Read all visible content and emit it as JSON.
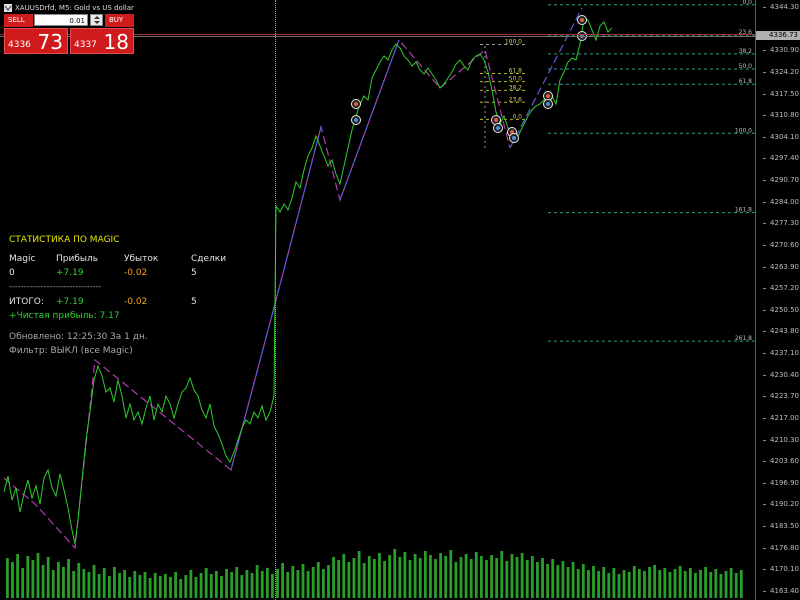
{
  "header": {
    "title": "XAUUSDrfd, M5: Gold vs US dollar"
  },
  "trade_panel": {
    "sell_label": "SELL",
    "buy_label": "BUY",
    "lot_value": "0.01",
    "sell_price_small": "4336",
    "sell_price_big": "73",
    "buy_price_small": "4337",
    "buy_price_big": "18"
  },
  "stats": {
    "title": "СТАТИСТИКА ПО MAGIC",
    "headers": [
      "Magic",
      "Прибыль",
      "Убыток",
      "Сделки"
    ],
    "row": {
      "magic": "0",
      "profit": "+7.19",
      "loss": "-0.02",
      "deals": "5"
    },
    "separator": "--------------------------------",
    "total_label": "ИТОГО:",
    "total_profit": "+7.19",
    "total_loss": "-0.02",
    "total_deals": "5",
    "net_profit": "+Чистая прибыль: 7.17",
    "updated": "Обновлено: 12:25:30",
    "period": "За 1 дн.",
    "filter": "Фильтр: ВЫКЛ (все Magic)"
  },
  "price_axis": {
    "current_price": "4336.73",
    "ticks": [
      {
        "label": "4344.30",
        "y": 4344.3
      },
      {
        "label": "4330.90",
        "y": 4330.9
      },
      {
        "label": "4324.20",
        "y": 4324.2
      },
      {
        "label": "4317.50",
        "y": 4317.5
      },
      {
        "label": "4310.80",
        "y": 4310.8
      },
      {
        "label": "4304.10",
        "y": 4304.1
      },
      {
        "label": "4297.40",
        "y": 4297.4
      },
      {
        "label": "4290.70",
        "y": 4290.7
      },
      {
        "label": "4284.00",
        "y": 4284.0
      },
      {
        "label": "4277.30",
        "y": 4277.3
      },
      {
        "label": "4270.60",
        "y": 4270.6
      },
      {
        "label": "4263.90",
        "y": 4263.9
      },
      {
        "label": "4257.20",
        "y": 4257.2
      },
      {
        "label": "4250.50",
        "y": 4250.5
      },
      {
        "label": "4243.80",
        "y": 4243.8
      },
      {
        "label": "4237.10",
        "y": 4237.1
      },
      {
        "label": "4230.40",
        "y": 4230.4
      },
      {
        "label": "4223.70",
        "y": 4223.7
      },
      {
        "label": "4217.00",
        "y": 4217.0
      },
      {
        "label": "4210.30",
        "y": 4210.3
      },
      {
        "label": "4203.60",
        "y": 4203.6
      },
      {
        "label": "4196.90",
        "y": 4196.9
      },
      {
        "label": "4190.20",
        "y": 4190.2
      },
      {
        "label": "4183.50",
        "y": 4183.5
      },
      {
        "label": "4176.80",
        "y": 4176.8
      },
      {
        "label": "4170.10",
        "y": 4170.1
      },
      {
        "label": "4163.40",
        "y": 4163.4
      }
    ]
  },
  "fib_right": [
    {
      "label": "0.0",
      "price": 4345.3
    },
    {
      "label": "23.6",
      "price": 4335.9
    },
    {
      "label": "38.2",
      "price": 4330.1
    },
    {
      "label": "50.0",
      "price": 4325.4
    },
    {
      "label": "61.8",
      "price": 4320.7
    },
    {
      "label": "100.0",
      "price": 4305.5
    },
    {
      "label": "161.8",
      "price": 4280.9
    },
    {
      "label": "261.8",
      "price": 4241.1
    }
  ],
  "fib_left": [
    {
      "label": "100.0",
      "price": 4333.0
    },
    {
      "label": "61.8",
      "price": 4324.0
    },
    {
      "label": "50.0",
      "price": 4321.5
    },
    {
      "label": "38.2",
      "price": 4318.8
    },
    {
      "label": "23.6",
      "price": 4315.1
    },
    {
      "label": "0.0",
      "price": 4309.8
    }
  ],
  "colors": {
    "price_line": "#2ecc2e",
    "zigzag_purple": "#b03ab0",
    "zigzag_blue": "#5b5bd8",
    "fib_line": "#2b9e8e",
    "volume": "#2a9e2a",
    "sell_red": "#cf1b1b"
  }
}
